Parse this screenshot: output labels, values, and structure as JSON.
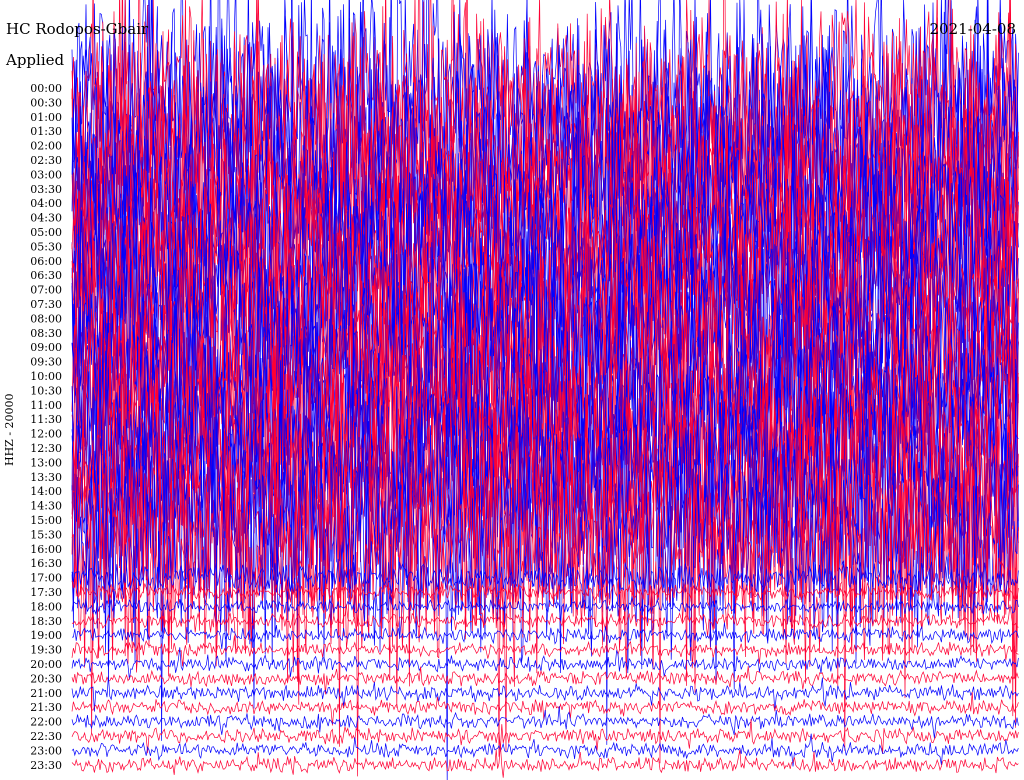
{
  "header": {
    "title": "HC Rodopos-Gbair",
    "subtitle": "Applied",
    "date": "2021-04-08"
  },
  "chart_data": {
    "type": "line",
    "chart_kind": "helicorder",
    "title": "HC Rodopos-Gbair",
    "subtitle": "Applied",
    "date": "2021-04-08",
    "ylabel": "HHZ - 20000",
    "row_labels": [
      "00:00",
      "00:30",
      "01:00",
      "01:30",
      "02:00",
      "02:30",
      "03:00",
      "03:30",
      "04:00",
      "04:30",
      "05:00",
      "05:30",
      "06:00",
      "06:30",
      "07:00",
      "07:30",
      "08:00",
      "08:30",
      "09:00",
      "09:30",
      "10:00",
      "10:30",
      "11:00",
      "11:30",
      "12:00",
      "12:30",
      "13:00",
      "13:30",
      "14:00",
      "14:30",
      "15:00",
      "15:30",
      "16:00",
      "16:30",
      "17:00",
      "17:30",
      "18:00",
      "18:30",
      "19:00",
      "19:30",
      "20:00",
      "20:30",
      "21:00",
      "21:30",
      "22:00",
      "22:30",
      "23:00",
      "23:30"
    ],
    "row_amplitude": [
      9,
      9,
      9,
      9,
      9,
      9,
      9,
      9,
      9,
      9,
      9,
      9,
      9,
      9,
      9,
      9,
      9,
      9,
      9,
      9,
      9,
      9,
      9,
      9,
      9,
      9,
      9,
      9,
      9,
      9,
      9,
      9,
      9,
      9,
      1.2,
      0.6,
      0.55,
      0.55,
      0.6,
      0.55,
      0.6,
      0.6,
      0.6,
      0.6,
      0.6,
      0.6,
      0.6,
      0.6
    ],
    "trace_colors": [
      "#0000ff",
      "#ff0033"
    ],
    "grid": false,
    "legend": "none"
  }
}
